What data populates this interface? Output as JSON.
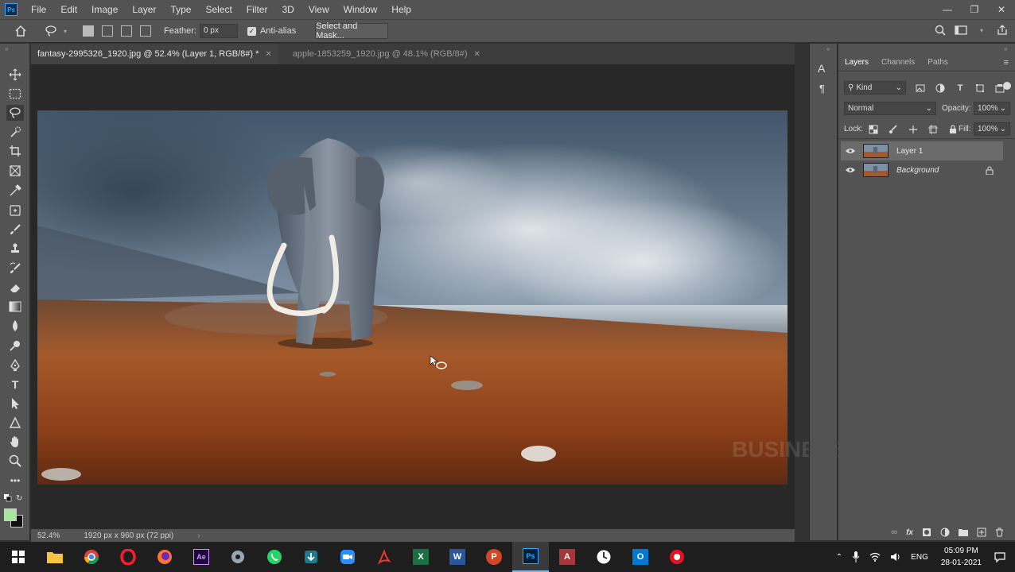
{
  "menubar": {
    "logo": "Ps",
    "items": [
      "File",
      "Edit",
      "Image",
      "Layer",
      "Type",
      "Select",
      "Filter",
      "3D",
      "View",
      "Window",
      "Help"
    ]
  },
  "options": {
    "feather_label": "Feather:",
    "feather_value": "0 px",
    "antialias_label": "Anti-alias",
    "antialias_checked": true,
    "select_mask_label": "Select and Mask..."
  },
  "tabs": [
    {
      "label": "fantasy-2995326_1920.jpg @ 52.4% (Layer 1, RGB/8#) *",
      "active": true
    },
    {
      "label": "apple-1853259_1920.jpg @ 48.1% (RGB/8#)",
      "active": false
    }
  ],
  "status": {
    "zoom": "52.4%",
    "doc_info": "1920 px x 960 px (72 ppi)"
  },
  "colors": {
    "foreground": "#a8e6a0",
    "background": "#111111"
  },
  "layers_panel": {
    "tabs": [
      "Layers",
      "Channels",
      "Paths"
    ],
    "filter_kind": "Kind",
    "blend_mode": "Normal",
    "opacity_label": "Opacity:",
    "opacity_value": "100%",
    "lock_label": "Lock:",
    "fill_label": "Fill:",
    "fill_value": "100%",
    "layers": [
      {
        "name": "Layer 1",
        "selected": true,
        "locked": false,
        "visible": true
      },
      {
        "name": "Background",
        "selected": false,
        "locked": true,
        "visible": true
      }
    ]
  },
  "watermark": "BUSINESS KNOWLEDGE",
  "taskbar": {
    "clock_time": "05:09 PM",
    "clock_date": "28-01-2021",
    "language": "ENG"
  }
}
